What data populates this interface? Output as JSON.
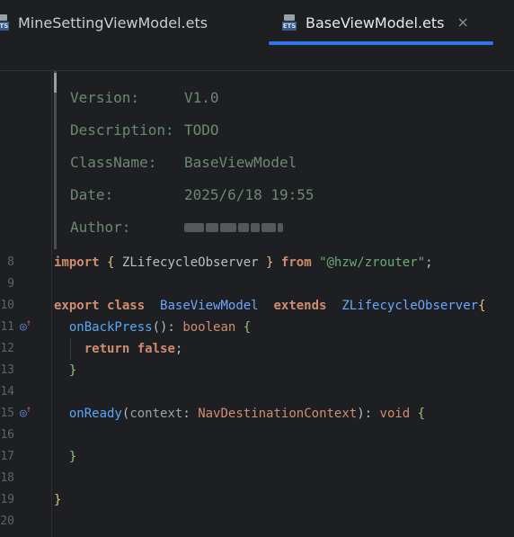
{
  "tabs": [
    {
      "label": "MineSettingViewModel.ets",
      "icon": "ets-file-icon",
      "active": false
    },
    {
      "label": "BaseViewModel.ets",
      "icon": "ets-file-icon",
      "active": true,
      "close": "×"
    }
  ],
  "file_icon_label": "ETS",
  "doc_comment": {
    "version_key": "Version:",
    "version_val": "V1.0",
    "desc_key": "Description:",
    "desc_val": "TODO",
    "class_key": "ClassName:",
    "class_val": "BaseViewModel",
    "date_key": "Date:",
    "date_val": "2025/6/18 19:55",
    "author_key": "Author:"
  },
  "line_numbers": [
    "8",
    "9",
    "10",
    "11",
    "12",
    "13",
    "14",
    "15",
    "16",
    "17",
    "18",
    "19",
    "20"
  ],
  "code": {
    "l8": {
      "import": "import",
      "open": "{",
      "name": "ZLifecycleObserver",
      "close": "}",
      "from": "from",
      "path": "\"@hzw/zrouter\"",
      "semi": ";"
    },
    "l10": {
      "export": "export",
      "class": "class",
      "name": "BaseViewModel",
      "extends": "extends",
      "parent": "ZLifecycleObserver",
      "brace": "{"
    },
    "l11": {
      "fn": "onBackPress",
      "parens": "():",
      "type": "boolean",
      "brace": "{"
    },
    "l12": {
      "ret": "return",
      "val": "false",
      "semi": ";"
    },
    "l13": {
      "brace": "}"
    },
    "l15": {
      "fn": "onReady",
      "open": "(",
      "param": "context",
      "colon": ":",
      "ptype": "NavDestinationContext",
      "close": "):",
      "rtype": "void",
      "brace": "{"
    },
    "l17": {
      "brace": "}"
    },
    "l19": {
      "brace": "}"
    }
  },
  "gutter_icons": [
    "override-icon",
    "override-icon"
  ],
  "colors": {
    "accent": "#3574f0",
    "keyword": "#cf8e6d",
    "string": "#6aab73",
    "function": "#56a8f5",
    "doc": "#6b8a6f"
  }
}
